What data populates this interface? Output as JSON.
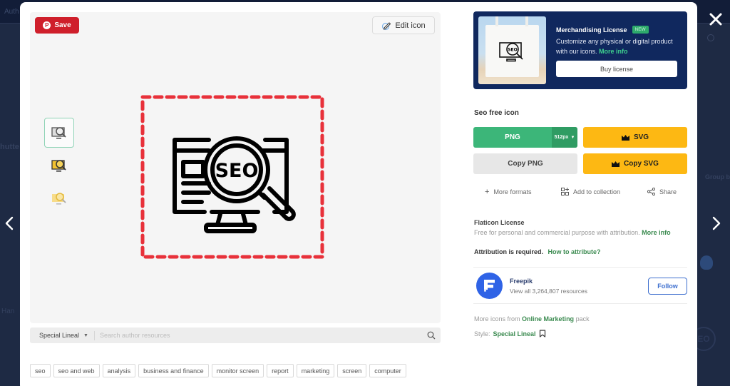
{
  "background": {
    "topbar_text": "Auth",
    "fragments": [
      "hutte",
      "Group b",
      "Han"
    ]
  },
  "modal": {
    "save_label": "Save",
    "edit_label": "Edit icon",
    "thumbnails": [
      {
        "name": "black-outline-variant",
        "active": true
      },
      {
        "name": "yellow-filled-variant",
        "active": false
      },
      {
        "name": "yellow-flat-variant",
        "active": false
      }
    ],
    "main_icon_text": "SEO",
    "search": {
      "style_value": "Special Lineal",
      "placeholder": "Search author resources"
    },
    "tags": [
      "seo",
      "seo and web",
      "analysis",
      "business and finance",
      "monitor screen",
      "report",
      "marketing",
      "screen",
      "computer"
    ]
  },
  "banner": {
    "title": "Merchandising License",
    "badge": "NEW",
    "desc": "Customize any physical or digital product with our icons.",
    "more_info": "More info",
    "buy_label": "Buy license"
  },
  "download": {
    "title": "Seo free icon",
    "png_label": "PNG",
    "size_value": "512px",
    "svg_label": "SVG",
    "copy_png_label": "Copy PNG",
    "copy_svg_label": "Copy SVG",
    "more_formats": "More formats",
    "add_collection": "Add to collection",
    "share": "Share"
  },
  "license": {
    "title": "Flaticon License",
    "desc": "Free for personal and commercial purpose with attribution.",
    "more_info": "More info",
    "attribution": "Attribution is required.",
    "how_to": "How to attribute?"
  },
  "author": {
    "name": "Freepik",
    "resources": "View all 3,264,807 resources",
    "follow_label": "Follow",
    "avatar_color": "#2f63e6"
  },
  "pack": {
    "prefix": "More icons from",
    "name": "Online Marketing",
    "suffix": "pack"
  },
  "style": {
    "prefix": "Style:",
    "name": "Special Lineal"
  },
  "colors": {
    "save": "#cf1f2b",
    "png": "#3cb679",
    "svg": "#fdb813",
    "banner": "#10285e",
    "link": "#3a8a4f",
    "dashed_border": "#e8313a"
  }
}
